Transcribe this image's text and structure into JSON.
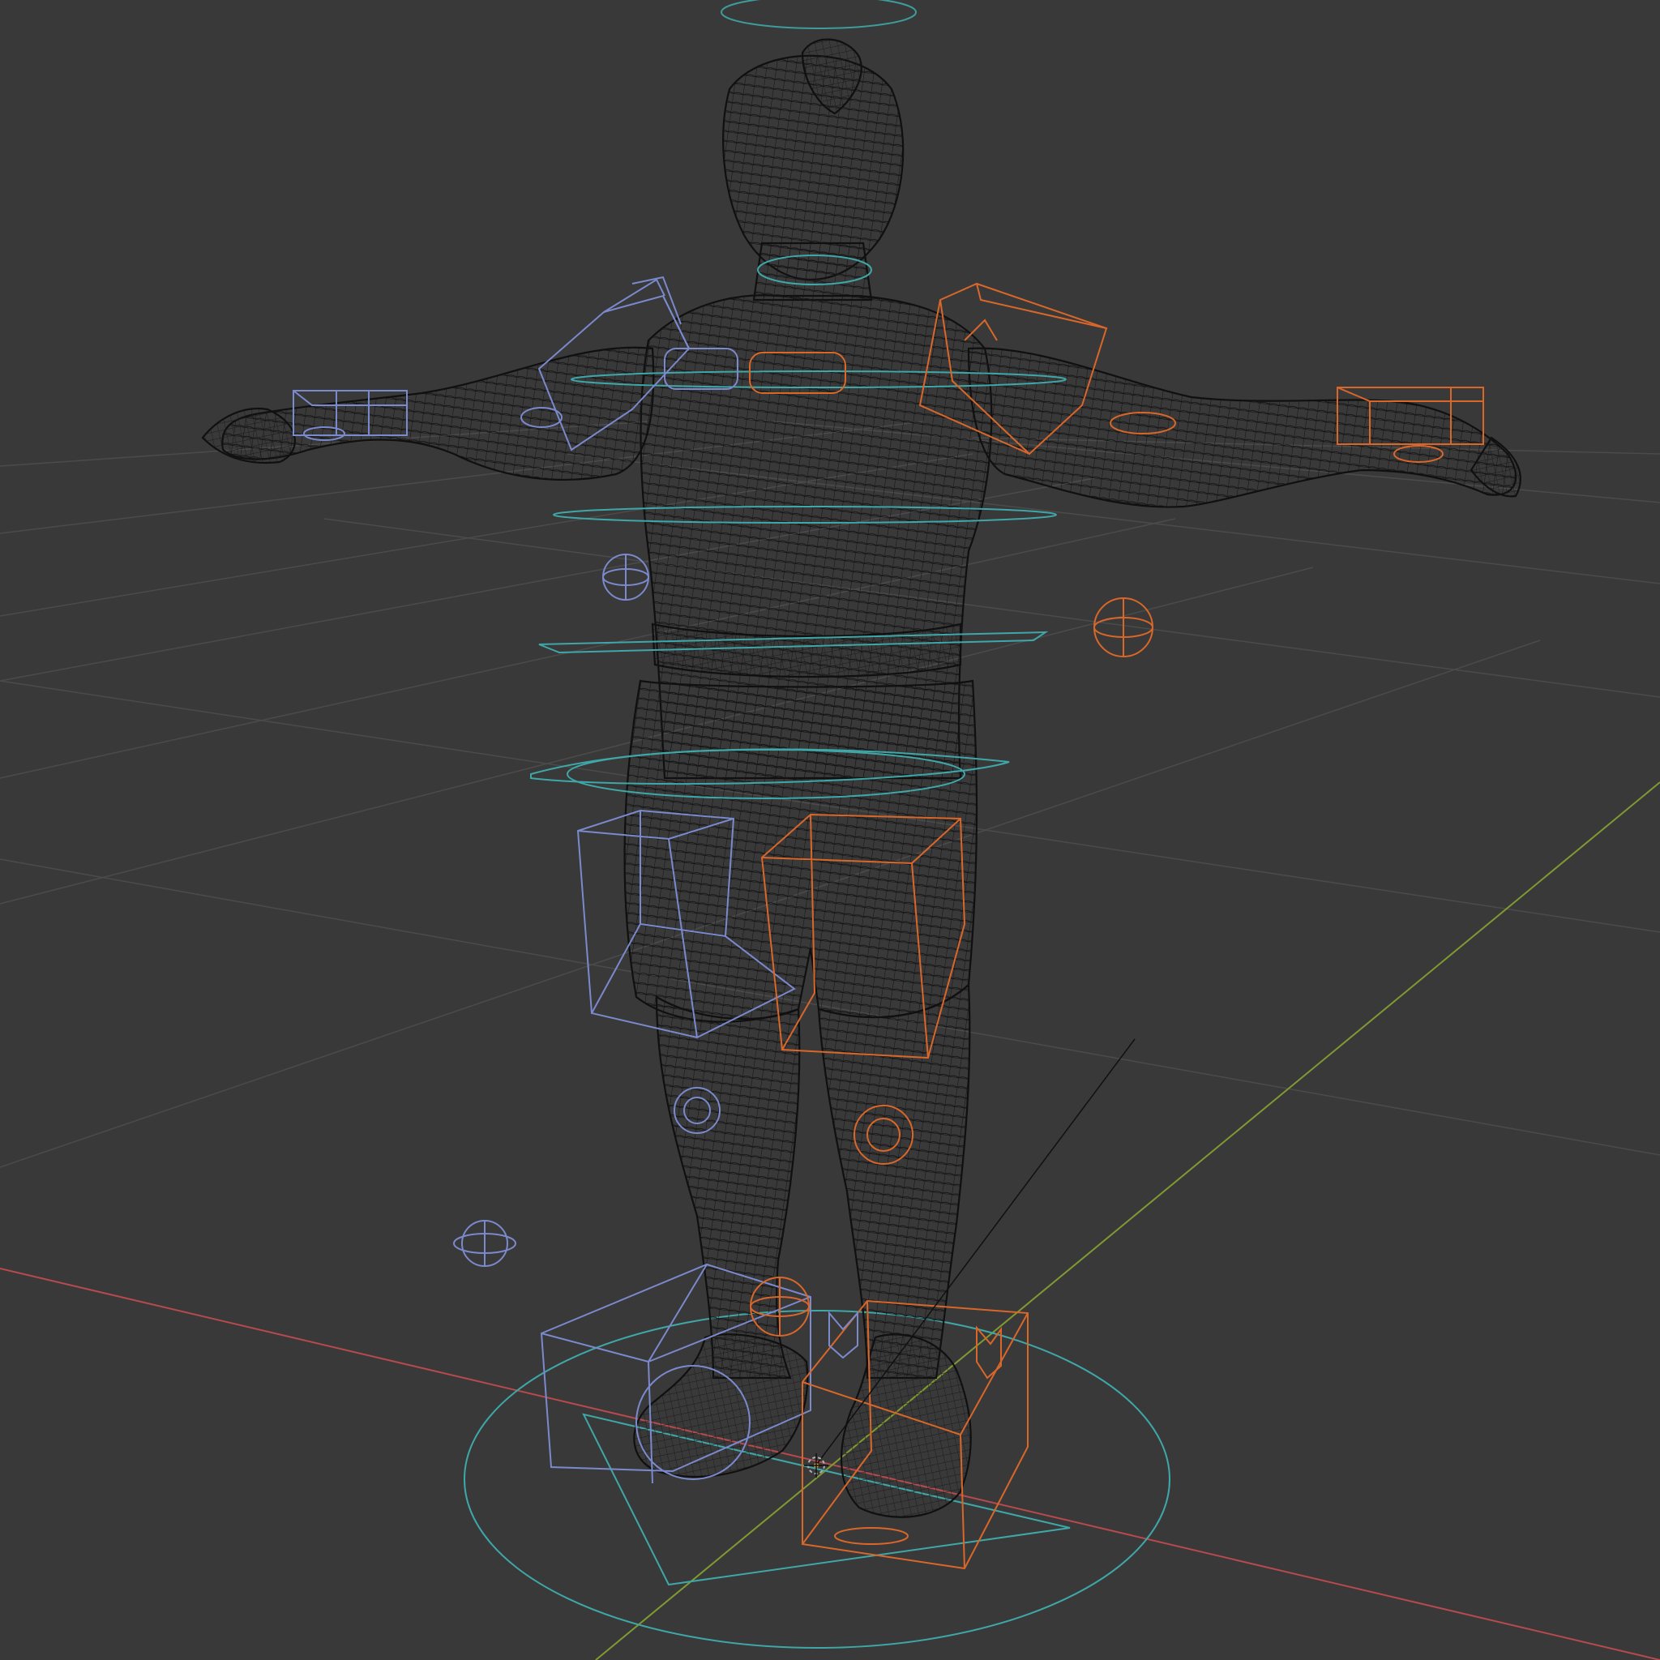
{
  "viewport": {
    "background": "#393939",
    "colors": {
      "grid": "#4b4b4b",
      "x_axis": "#b64a4e",
      "y_axis": "#7f9a32",
      "mesh": "#141414",
      "root_control": "#3fa7a8",
      "left_controls": "#7b89cd",
      "right_controls": "#d9672a"
    },
    "objects": {
      "mesh": "character-wireframe-mesh",
      "rig": "control-rig",
      "cursor": "3d-cursor-icon"
    }
  }
}
